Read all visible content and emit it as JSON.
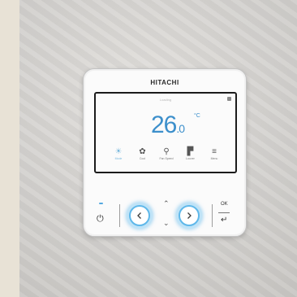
{
  "device": {
    "brand": "HITACHI",
    "screen_title": "Loading",
    "temperature": "26",
    "temperature_decimal": ".0",
    "unit": "°C"
  },
  "screen_icons": [
    {
      "name": "mode-icon",
      "glyph": "☀",
      "label": "Mode",
      "accent": true
    },
    {
      "name": "cool-icon",
      "glyph": "✿",
      "label": "Cool",
      "accent": false
    },
    {
      "name": "fan-speed-icon",
      "glyph": "⚲",
      "label": "Fan Speed",
      "accent": false
    },
    {
      "name": "louver-icon",
      "glyph": "▛",
      "label": "Louver",
      "accent": false
    },
    {
      "name": "menu-icon",
      "glyph": "≡",
      "label": "Menu",
      "accent": false
    }
  ],
  "buttons": {
    "power_glyph": "⏻",
    "up_glyph": "⌃",
    "down_glyph": "⌄",
    "ok_label": "OK",
    "back_glyph": "↵"
  },
  "colors": {
    "accent": "#3c8fcb",
    "ring": "#5fb8ea"
  }
}
